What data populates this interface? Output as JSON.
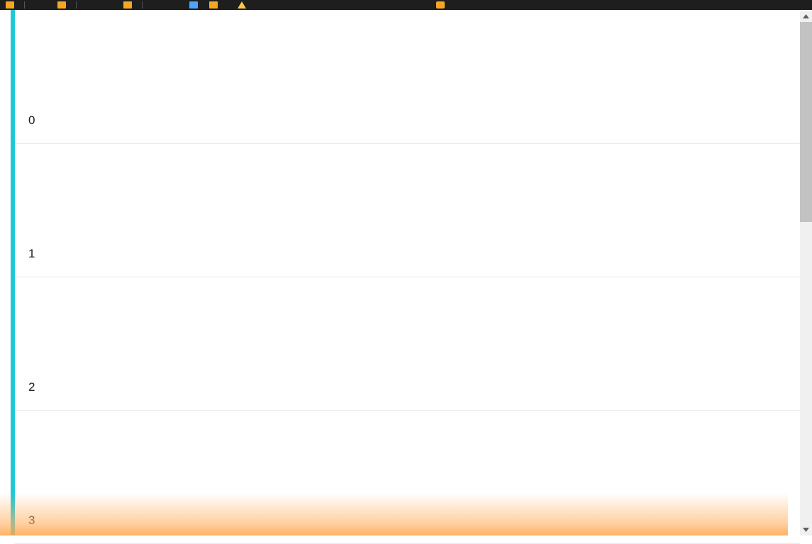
{
  "cells": [
    {
      "index": "0"
    },
    {
      "index": "1"
    },
    {
      "index": "2"
    },
    {
      "index": "3"
    }
  ],
  "colors": {
    "toolbar_bg": "#1e1e1e",
    "selection_bar": "#1fc8d8",
    "icon_orange": "#f5a623",
    "icon_blue": "#4da3ff",
    "icon_yellow": "#f9c846",
    "scrollbar_thumb": "#c2c2c2",
    "scrollbar_track": "#f0f0f0",
    "cell_border": "#e9e9e9",
    "gradient_color": "#ffb266"
  }
}
